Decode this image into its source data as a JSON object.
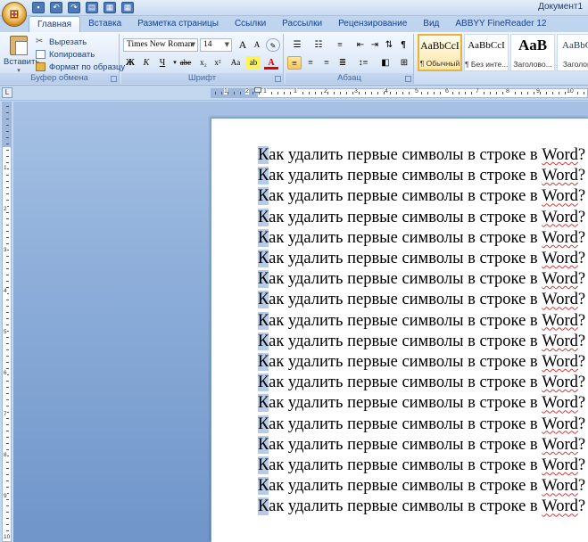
{
  "window": {
    "doc_title": "Документ1"
  },
  "tabs": [
    {
      "label": "Главная",
      "active": true
    },
    {
      "label": "Вставка",
      "active": false
    },
    {
      "label": "Разметка страницы",
      "active": false
    },
    {
      "label": "Ссылки",
      "active": false
    },
    {
      "label": "Рассылки",
      "active": false
    },
    {
      "label": "Рецензирование",
      "active": false
    },
    {
      "label": "Вид",
      "active": false
    },
    {
      "label": "ABBYY FineReader 12",
      "active": false
    }
  ],
  "clipboard": {
    "paste_label": "Вставить",
    "cut_label": "Вырезать",
    "copy_label": "Копировать",
    "format_painter_label": "Формат по образцу",
    "group_label": "Буфер обмена"
  },
  "font": {
    "family": "Times New Roman",
    "size": "14",
    "group_label": "Шрифт",
    "bold": "Ж",
    "italic": "К",
    "underline": "Ч",
    "strike": "abe",
    "subscript": "x₂",
    "superscript": "x²",
    "case": "Aa",
    "grow": "A",
    "shrink": "A"
  },
  "paragraph": {
    "group_label": "Абзац"
  },
  "styles": [
    {
      "sample": "AaBbCcI",
      "name": "¶ Обычный",
      "active": true
    },
    {
      "sample": "AaBbCcI",
      "name": "¶ Без инте...",
      "active": false
    },
    {
      "sample": "AaB",
      "name": "Заголово...",
      "active": false,
      "big": true
    },
    {
      "sample": "AaBbCc",
      "name": "Заголово",
      "active": false
    }
  ],
  "ruler": {
    "numbers": [
      "1",
      "2",
      "1",
      "1",
      "2",
      "3",
      "4",
      "5",
      "6",
      "7",
      "8",
      "9",
      "10"
    ],
    "v_numbers": [
      "1",
      "2",
      "3",
      "4",
      "5",
      "6",
      "7",
      "8",
      "9",
      "10"
    ]
  },
  "document": {
    "first_char": "К",
    "rest_before_word": "ак удалить первые символы в строке в ",
    "word": "Word",
    "end": "?",
    "line_count": 18
  }
}
